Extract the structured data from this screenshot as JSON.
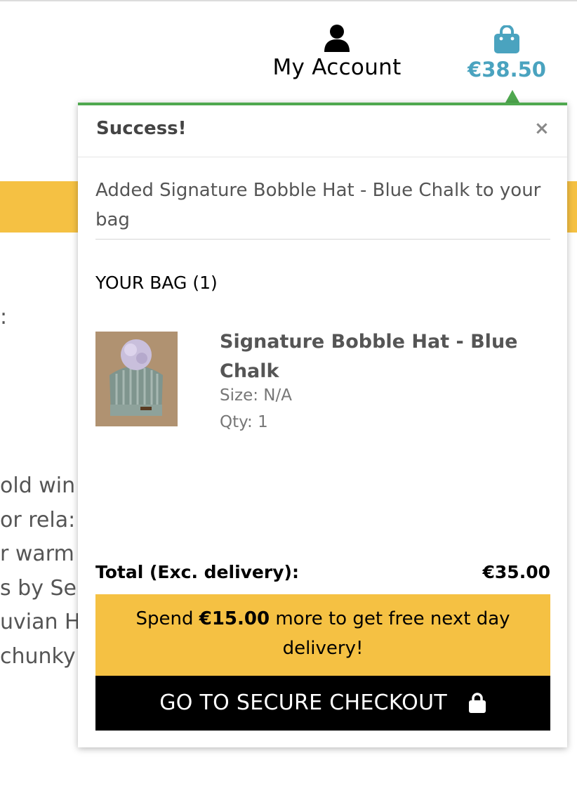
{
  "header": {
    "account_icon": "user-icon",
    "account_label": "My Account",
    "bag_icon": "shopping-bag-icon",
    "bag_total": "€38.50",
    "bag_color": "#4aa3bf"
  },
  "background": {
    "banner_color": "#f5c143",
    "glyph": ":",
    "lines": [
      "old win",
      "or rela:",
      "r warm",
      "s by Se",
      "uvian H",
      "chunky"
    ]
  },
  "popup": {
    "title": "Success!",
    "close_icon": "close-icon",
    "close_glyph": "×",
    "message": "Added Signature Bobble Hat - Blue Chalk to your bag",
    "bag_heading": "YOUR BAG (1)",
    "accent_color": "#4fa84f",
    "item": {
      "name": "Signature Bobble Hat - Blue Chalk",
      "size": "Size: N/A",
      "qty": "Qty: 1"
    },
    "total_label": "Total (Exc. delivery):",
    "total_value": "€35.00",
    "delivery": {
      "prefix": "Spend",
      "amount": "€15.00",
      "suffix": "more to get free next day delivery!"
    },
    "checkout_label": "GO TO SECURE CHECKOUT",
    "checkout_icon": "lock-icon"
  }
}
